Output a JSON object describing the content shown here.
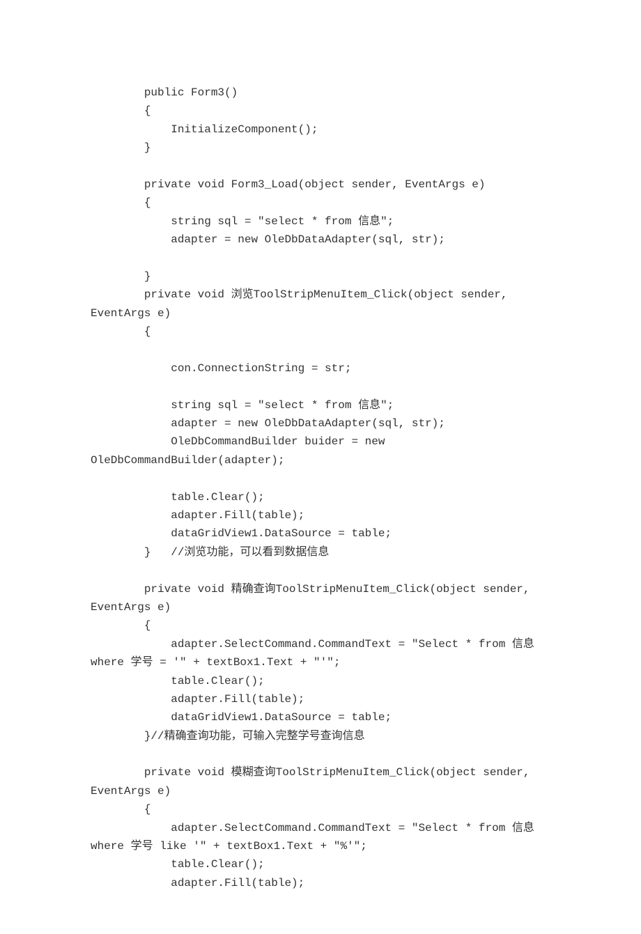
{
  "code": {
    "lines": [
      "        public Form3()",
      "        {",
      "            InitializeComponent();",
      "        }",
      "",
      "        private void Form3_Load(object sender, EventArgs e)",
      "        {",
      "            string sql = \"select * from 信息\";",
      "            adapter = new OleDbDataAdapter(sql, str);",
      "",
      "        }",
      "        private void 浏览ToolStripMenuItem_Click(object sender, EventArgs e)",
      "        {",
      "",
      "            con.ConnectionString = str;",
      "",
      "            string sql = \"select * from 信息\";",
      "            adapter = new OleDbDataAdapter(sql, str);",
      "            OleDbCommandBuilder buider = new OleDbCommandBuilder(adapter);",
      "",
      "            table.Clear();",
      "            adapter.Fill(table);",
      "            dataGridView1.DataSource = table;",
      "        }   //浏览功能，可以看到数据信息",
      "",
      "        private void 精确查询ToolStripMenuItem_Click(object sender, EventArgs e)",
      "        {",
      "            adapter.SelectCommand.CommandText = \"Select * from 信息 where 学号 = '\" + textBox1.Text + \"'\";",
      "            table.Clear();",
      "            adapter.Fill(table);",
      "            dataGridView1.DataSource = table;",
      "        }//精确查询功能，可输入完整学号查询信息",
      "",
      "        private void 模糊查询ToolStripMenuItem_Click(object sender, EventArgs e)",
      "        {",
      "            adapter.SelectCommand.CommandText = \"Select * from 信息 where 学号 like '\" + textBox1.Text + \"%'\";",
      "            table.Clear();",
      "            adapter.Fill(table);"
    ]
  }
}
